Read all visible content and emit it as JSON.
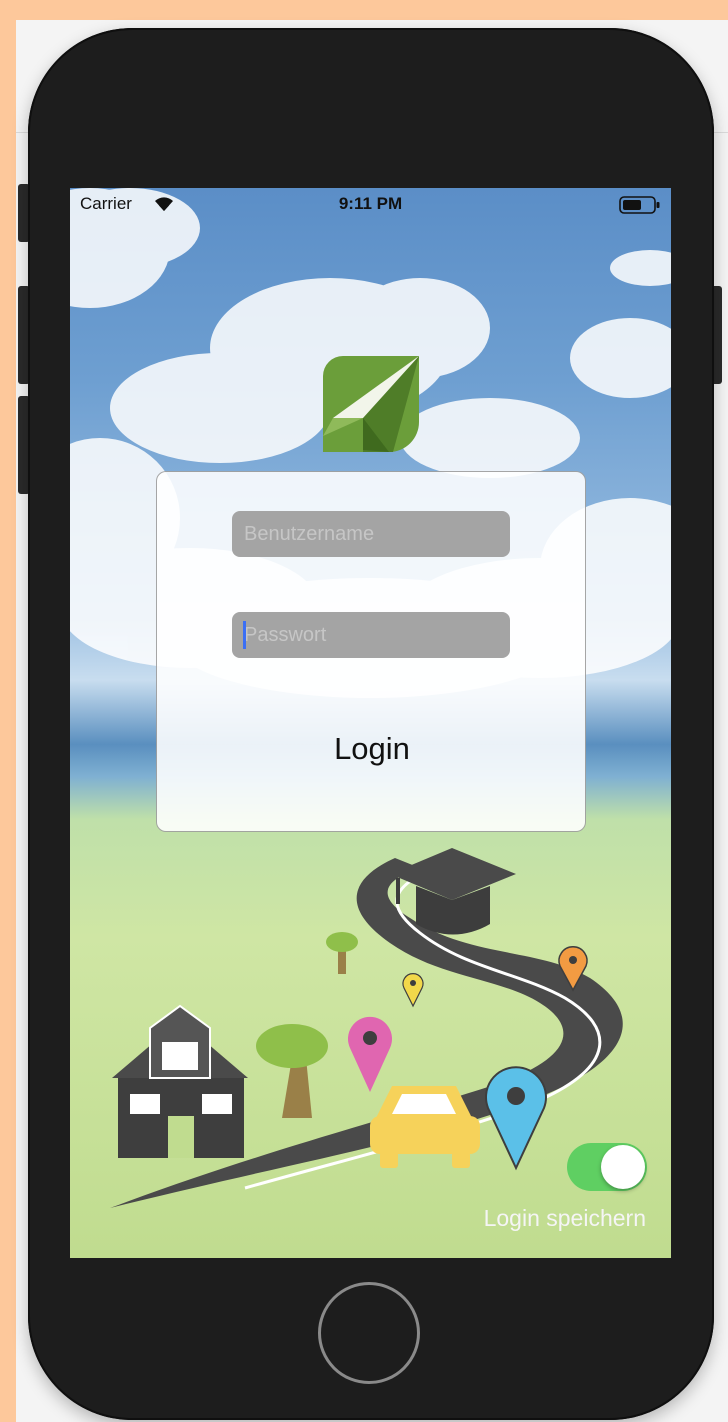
{
  "status_bar": {
    "carrier": "Carrier",
    "time": "9:11 PM"
  },
  "login": {
    "username_placeholder": "Benutzername",
    "password_placeholder": "Passwort",
    "button_label": "Login"
  },
  "remember": {
    "label": "Login speichern",
    "enabled": true
  },
  "icons": [
    "wifi-icon",
    "battery-icon",
    "app-logo-icon",
    "house-icon",
    "graduation-cap-icon",
    "car-icon",
    "map-pin-icon",
    "tree-icon"
  ],
  "colors": {
    "toggle_on": "#5fcf62",
    "logo_green": "#6b9e3a",
    "pin_pink": "#e066b0",
    "pin_blue": "#5bc0e8",
    "pin_orange": "#f29b42",
    "pin_yellow": "#f2d84a",
    "car": "#f6d25a"
  }
}
